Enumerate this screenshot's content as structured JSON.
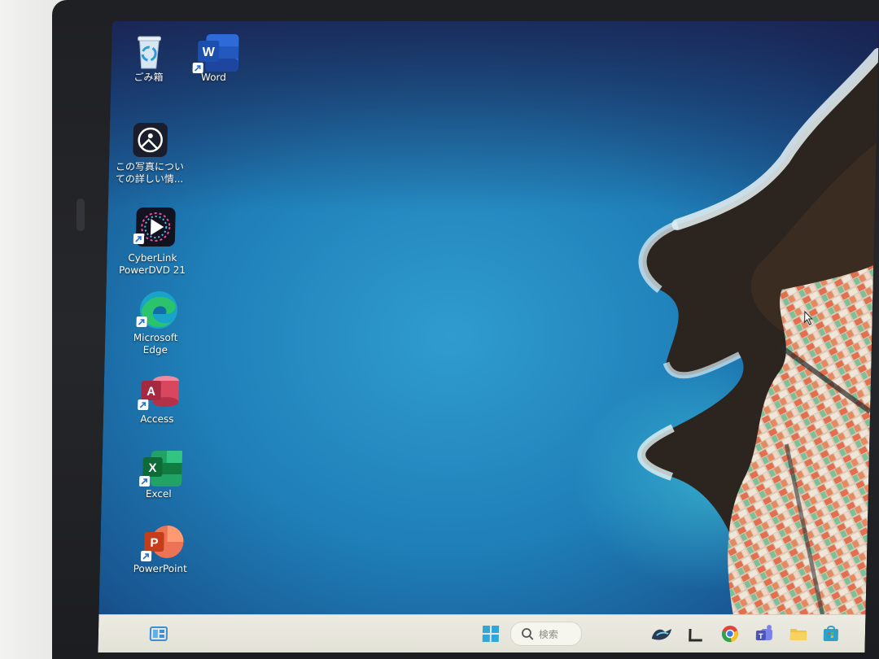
{
  "desktop": {
    "icons": [
      {
        "label": "ごみ箱",
        "icon": "recycle-bin-icon"
      },
      {
        "label": "Word",
        "icon": "word-icon"
      },
      {
        "label": "この写真につい\nての詳しい情...",
        "icon": "photo-info-icon"
      },
      {
        "label": "CyberLink\nPowerDVD 21",
        "icon": "powerdvd-icon"
      },
      {
        "label": "Microsoft\nEdge",
        "icon": "edge-icon"
      },
      {
        "label": "Access",
        "icon": "access-icon"
      },
      {
        "label": "Excel",
        "icon": "excel-icon"
      },
      {
        "label": "PowerPoint",
        "icon": "powerpoint-icon"
      }
    ]
  },
  "taskbar": {
    "search_placeholder": "検索",
    "icons": [
      "widgets-icon",
      "start-icon",
      "search-icon",
      "copilot-icon",
      "task-view-icon",
      "chrome-icon",
      "teams-icon",
      "file-explorer-icon",
      "store-icon"
    ]
  },
  "colors": {
    "word": "#2b5fc7",
    "excel": "#1f9d55",
    "powerpoint": "#d9553b",
    "access": "#c43e52",
    "edge": "#1ea0c8",
    "taskbar": "#e8e7dd"
  }
}
